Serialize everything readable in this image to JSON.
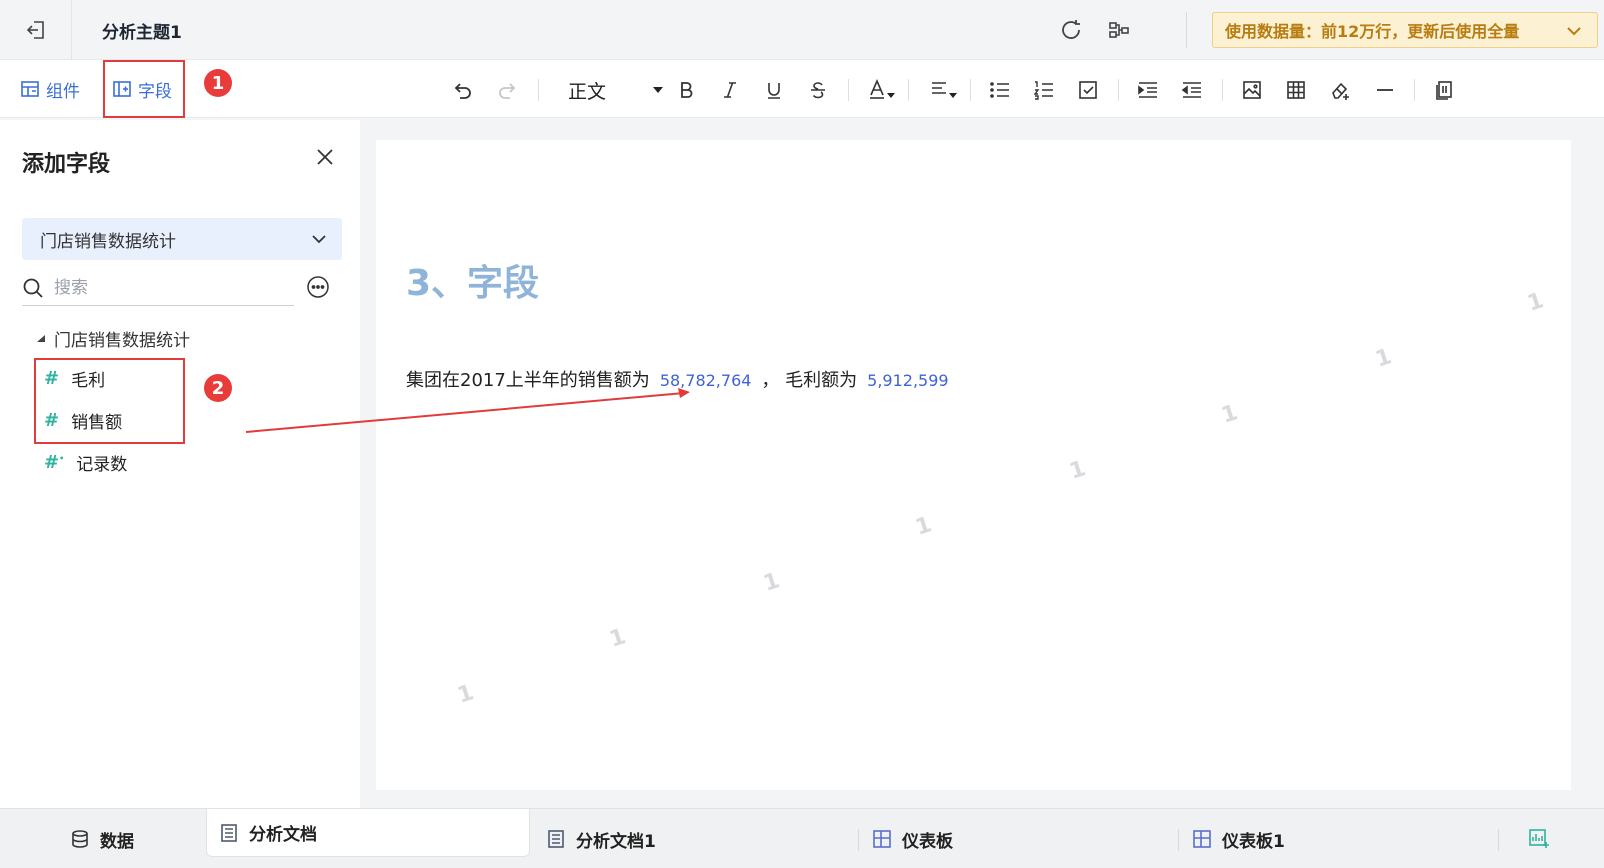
{
  "header": {
    "doc_title": "分析主题1",
    "banner_text": "使用数据量：前12万行，更新后使用全量"
  },
  "toolbar": {
    "components_label": "组件",
    "fields_label": "字段",
    "style_select": "正文",
    "badge1": "1",
    "badge2": "2"
  },
  "panel": {
    "title": "添加字段",
    "dataset": "门店销售数据统计",
    "search_placeholder": "搜索",
    "tree_root": "门店销售数据统计",
    "fields": [
      {
        "label": "毛利"
      },
      {
        "label": "销售额"
      },
      {
        "label": "记录数"
      }
    ]
  },
  "canvas": {
    "heading": "3、字段",
    "text1": "集团在2017上半年的销售额为",
    "value1": "58,782,764",
    "text2": "，  毛利额为",
    "value2": "5,912,599",
    "watermark": "1"
  },
  "bottom_tabs": [
    {
      "label": "数据"
    },
    {
      "label": "分析文档"
    },
    {
      "label": "分析文档1"
    },
    {
      "label": "仪表板"
    },
    {
      "label": "仪表板1"
    }
  ],
  "colors": {
    "accent": "#3a6fd8",
    "highlight_red": "#e23b3b",
    "field_value": "#3f63d6",
    "heading": "#8fb4d9",
    "banner_bg": "#fdf1d4"
  }
}
